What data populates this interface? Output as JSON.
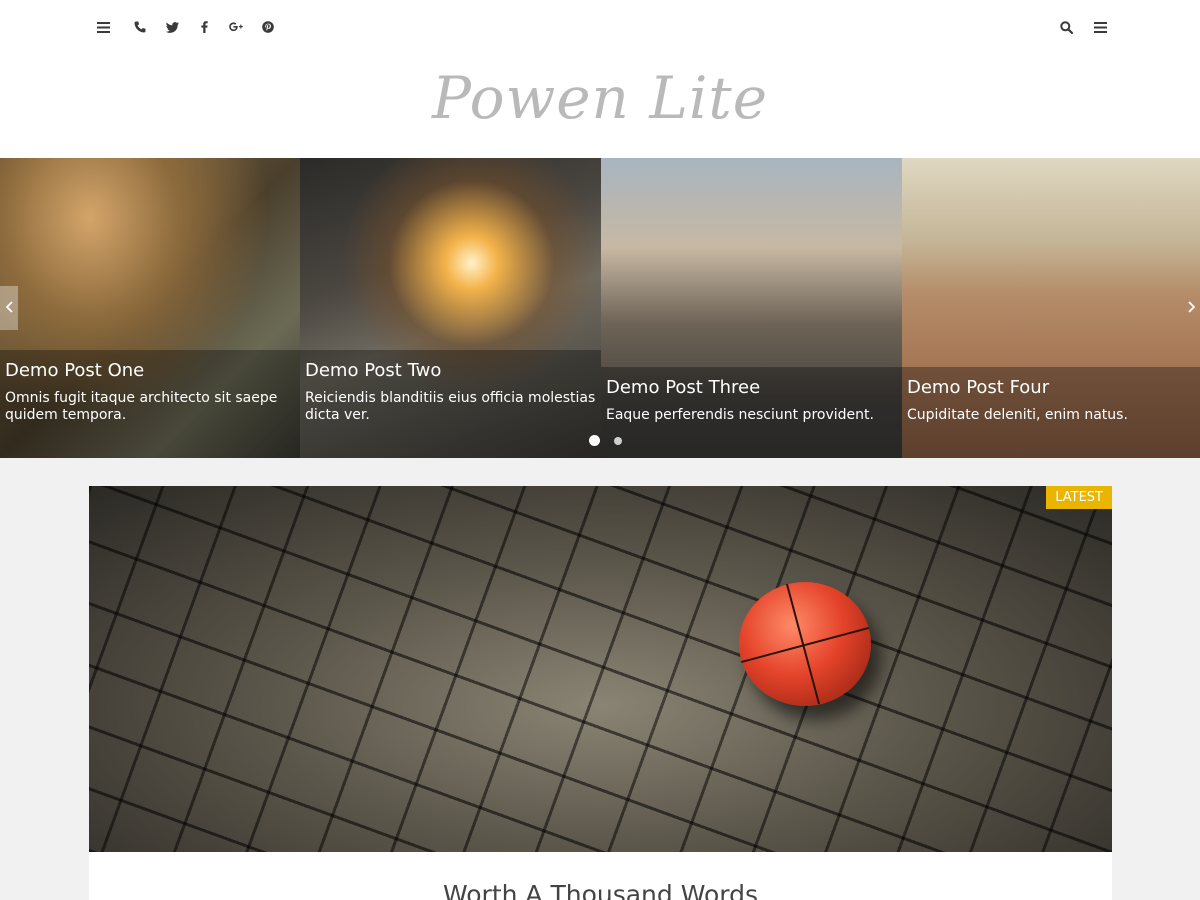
{
  "header": {
    "site_title": "Powen Lite",
    "social_icons": [
      "menu-icon",
      "phone-icon",
      "twitter-icon",
      "facebook-icon",
      "google-plus-icon",
      "pinterest-icon"
    ],
    "right_icons": [
      "search-icon",
      "menu-icon"
    ]
  },
  "slider": {
    "slides": [
      {
        "title": "Demo Post One",
        "excerpt": "Omnis fugit itaque architecto sit saepe quidem tempora."
      },
      {
        "title": "Demo Post Two",
        "excerpt": "Reiciendis blanditiis eius officia molestias dicta ver."
      },
      {
        "title": "Demo Post Three",
        "excerpt": "Eaque perferendis nesciunt provident."
      },
      {
        "title": "Demo Post Four",
        "excerpt": "Cupiditate deleniti, enim natus."
      }
    ],
    "prev_icon": "chevron-left-icon",
    "next_icon": "chevron-right-icon",
    "dots": {
      "count": 2,
      "active": 1
    }
  },
  "featured": {
    "badge": "LATEST",
    "title": "Worth A Thousand Words"
  },
  "colors": {
    "badge": "#e9b500",
    "page_background": "#f1f1f1",
    "site_title": "#b9b9b9"
  }
}
